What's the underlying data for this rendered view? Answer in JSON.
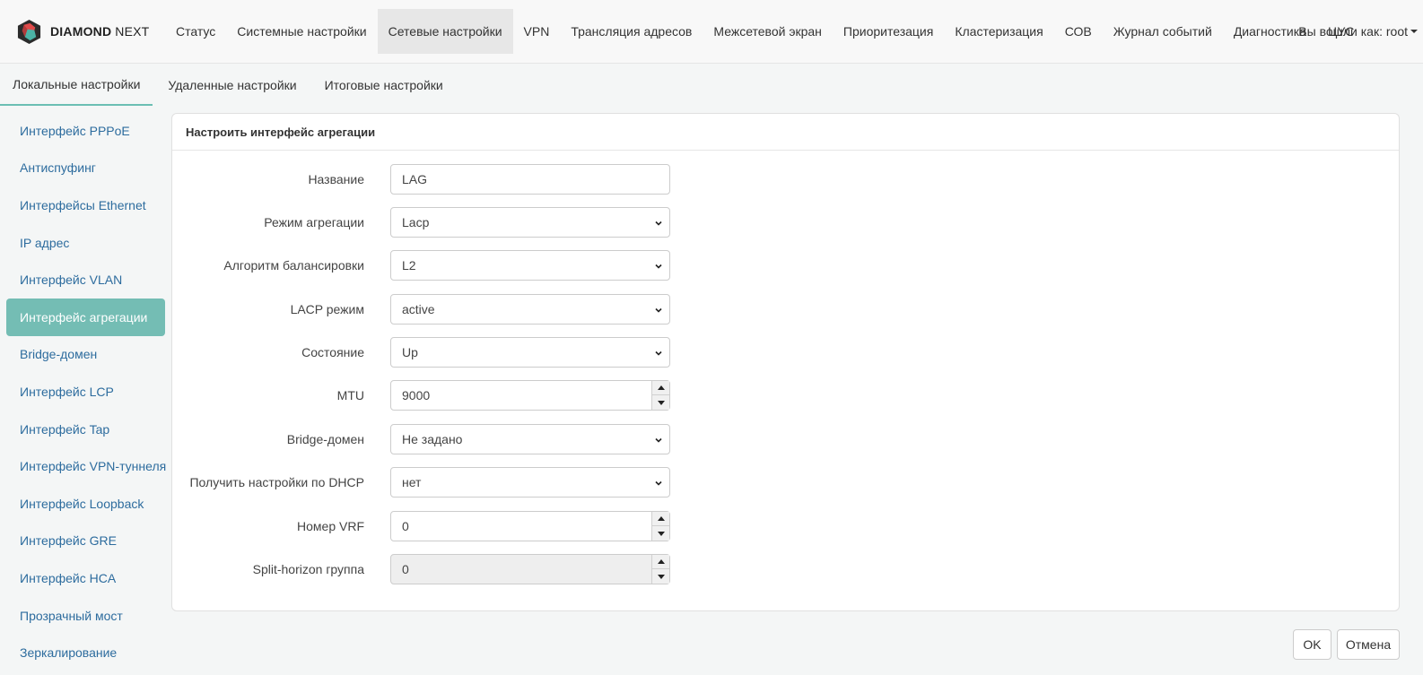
{
  "brand": {
    "name_bold": "DIAMOND",
    "name_light": "NEXT"
  },
  "nav": {
    "items": [
      {
        "label": "Статус"
      },
      {
        "label": "Системные настройки"
      },
      {
        "label": "Сетевые настройки"
      },
      {
        "label": "VPN"
      },
      {
        "label": "Трансляция адресов"
      },
      {
        "label": "Межсетевой экран"
      },
      {
        "label": "Приоритезация"
      },
      {
        "label": "Кластеризация"
      },
      {
        "label": "СОВ"
      },
      {
        "label": "Журнал событий"
      },
      {
        "label": "Диагностика"
      },
      {
        "label": "ЦУС"
      }
    ],
    "active_index": 2,
    "user_label": "Вы вошли как: root"
  },
  "subtabs": {
    "items": [
      {
        "label": "Локальные настройки"
      },
      {
        "label": "Удаленные настройки"
      },
      {
        "label": "Итоговые настройки"
      }
    ],
    "active_index": 0
  },
  "sidebar": {
    "items": [
      {
        "label": "Интерфейс PPPoE"
      },
      {
        "label": "Антиспуфинг"
      },
      {
        "label": "Интерфейсы Ethernet"
      },
      {
        "label": "IP адрес"
      },
      {
        "label": "Интерфейс VLAN"
      },
      {
        "label": "Интерфейс агрегации"
      },
      {
        "label": "Bridge-домен"
      },
      {
        "label": "Интерфейс LCP"
      },
      {
        "label": "Интерфейс Tap"
      },
      {
        "label": "Интерфейс VPN-туннеля"
      },
      {
        "label": "Интерфейс Loopback"
      },
      {
        "label": "Интерфейс GRE"
      },
      {
        "label": "Интерфейс HCA"
      },
      {
        "label": "Прозрачный мост"
      },
      {
        "label": "Зеркалирование"
      }
    ],
    "active_index": 5
  },
  "panel": {
    "title": "Настроить интерфейс агрегации"
  },
  "form": {
    "name": {
      "label": "Название",
      "value": "LAG"
    },
    "aggregation_mode": {
      "label": "Режим агрегации",
      "value": "Lacp"
    },
    "balancing_algorithm": {
      "label": "Алгоритм балансировки",
      "value": "L2"
    },
    "lacp_mode": {
      "label": "LACP режим",
      "value": "active"
    },
    "state": {
      "label": "Состояние",
      "value": "Up"
    },
    "mtu": {
      "label": "MTU",
      "value": "9000"
    },
    "bridge_domain": {
      "label": "Bridge-домен",
      "value": "Не задано"
    },
    "dhcp": {
      "label": "Получить настройки по DHCP",
      "value": "нет"
    },
    "vrf": {
      "label": "Номер VRF",
      "value": "0"
    },
    "split_horizon": {
      "label": "Split-horizon группа",
      "value": "0"
    }
  },
  "buttons": {
    "ok": "OK",
    "cancel": "Отмена"
  },
  "colors": {
    "accent": "#74bdb4",
    "link": "#2d6c9e"
  }
}
